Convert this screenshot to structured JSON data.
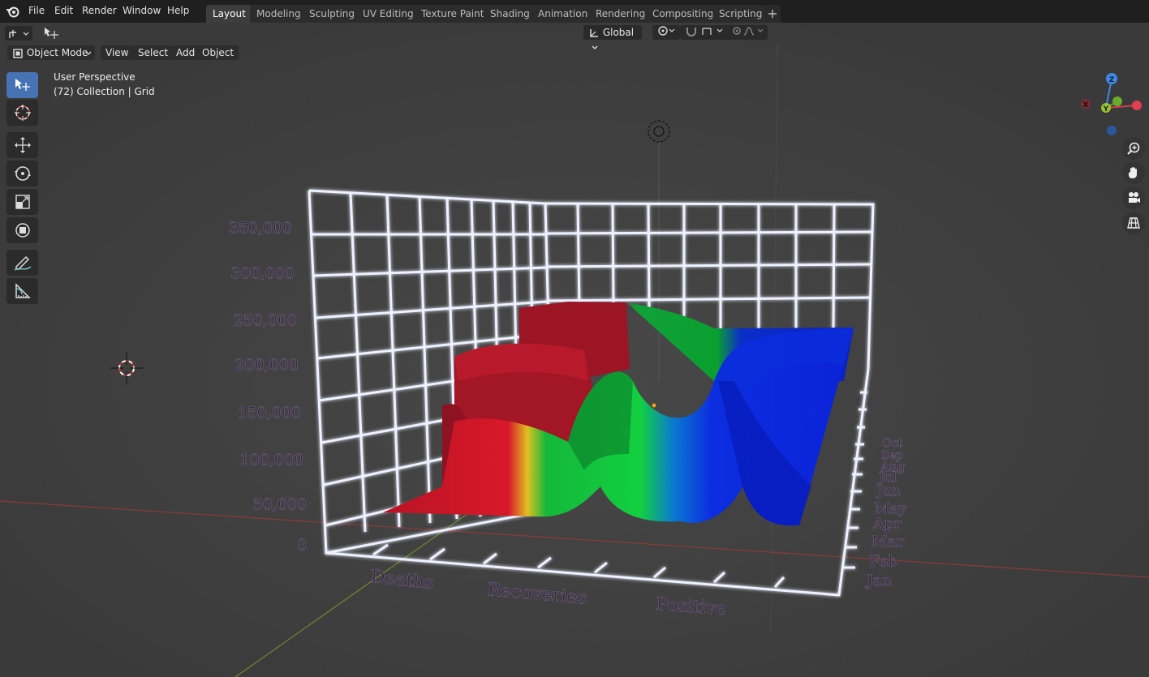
{
  "menu": [
    "File",
    "Edit",
    "Render",
    "Window",
    "Help"
  ],
  "workspaces": [
    {
      "label": "Layout",
      "active": true
    },
    {
      "label": "Modeling"
    },
    {
      "label": "Sculpting"
    },
    {
      "label": "UV Editing"
    },
    {
      "label": "Texture Paint"
    },
    {
      "label": "Shading"
    },
    {
      "label": "Animation"
    },
    {
      "label": "Rendering"
    },
    {
      "label": "Compositing"
    },
    {
      "label": "Scripting"
    }
  ],
  "header": {
    "mode": "Object Mode",
    "view": "View",
    "select": "Select",
    "add": "Add",
    "object": "Object",
    "orientation": "Global"
  },
  "overlay": {
    "perspective": "User Perspective",
    "collection": "(72) Collection | Grid"
  },
  "gizmo": {
    "x": "X",
    "y": "Y",
    "z": "Z"
  },
  "chart": {
    "y_ticks": [
      "350,000",
      "300,000",
      "250,000",
      "200,000",
      "150,000",
      "100,000",
      "50,000",
      "0"
    ],
    "categories": [
      "Deaths",
      "Recoveries",
      "Positive"
    ],
    "months": [
      "Jan",
      "Feb",
      "Mar",
      "Apr",
      "May",
      "Jun",
      "Jul",
      "Aug",
      "Sep",
      "Oct"
    ]
  },
  "colors": {
    "deaths": "#c41a2e",
    "recoveries": "#12c23a",
    "positive": "#0b2ee0",
    "grid": "#e8ecff",
    "accent": "#4772b3"
  }
}
